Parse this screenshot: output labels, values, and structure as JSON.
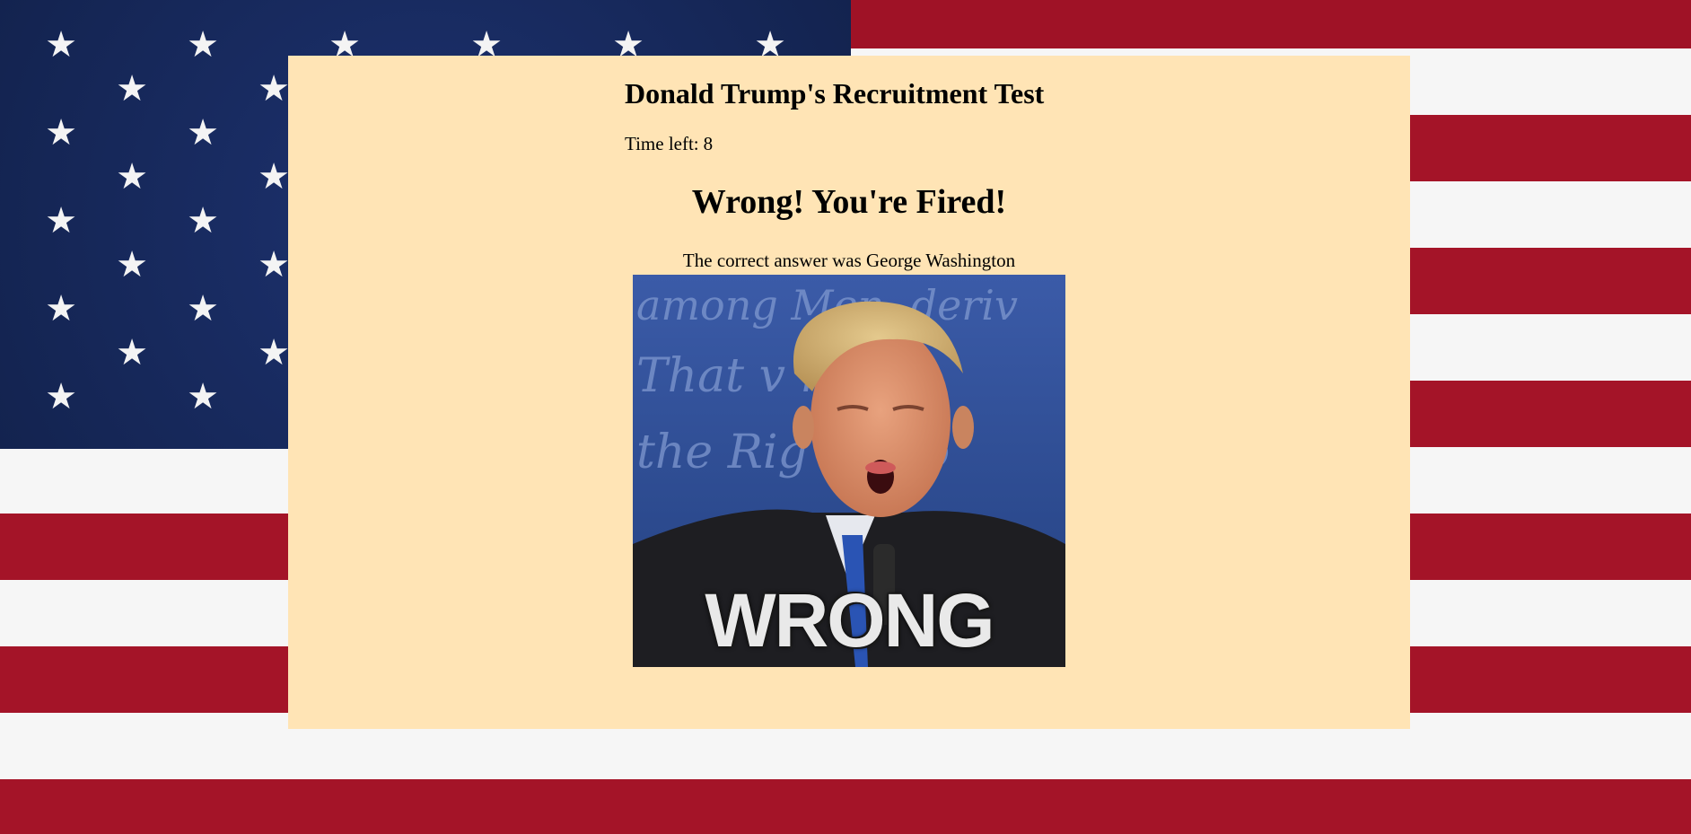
{
  "app": {
    "title": "Donald Trump's Recruitment Test"
  },
  "timer": {
    "label": "Time left:",
    "value": "8"
  },
  "result": {
    "heading": "Wrong! You're Fired!",
    "answer_text": "The correct answer was George Washington"
  },
  "image": {
    "caption": "WRONG",
    "background_script": "among Men, deriv That v r an the Rig e Peo"
  },
  "colors": {
    "panel": "#ffe4b5",
    "flag_red": "#a01428",
    "flag_white": "#f7f7f7",
    "flag_blue": "#16285e"
  },
  "icons": {
    "star": "star-icon"
  }
}
